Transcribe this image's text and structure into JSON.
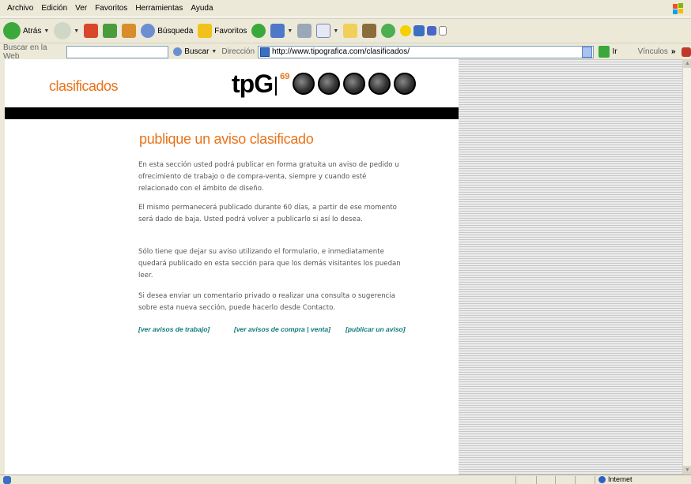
{
  "menu": [
    "Archivo",
    "Edición",
    "Ver",
    "Favoritos",
    "Herramientas",
    "Ayuda"
  ],
  "toolbar": {
    "back_label": "Atrás",
    "search_label": "Búsqueda",
    "favorites_label": "Favoritos"
  },
  "addressbar": {
    "search_label": "Buscar en la Web",
    "search_button": "Buscar",
    "address_label": "Dirección",
    "url": "http://www.tipografica.com/clasificados/",
    "go_label": "Ir",
    "links_label": "Vínculos"
  },
  "page": {
    "section": "clasificados",
    "logo_text": "tpG",
    "logo_number": "69",
    "headline": "publique un aviso clasificado",
    "paragraphs": [
      "En esta sección usted podrá publicar en forma gratuita un aviso de pedido u ofrecimiento de trabajo o de compra-venta, siempre y cuando esté relacionado con el ámbito de diseño.",
      "El mismo permanecerá publicado durante 60 días, a partir de ese momento será dado de baja. Usted podrá volver a publicarlo si así lo desea.",
      "Sólo tiene que dejar su aviso utilizando el formulario, e inmediatamente quedará publicado en esta sección para que los demás visitantes los puedan leer.",
      "Si desea enviar un comentario privado o realizar una consulta o sugerencia sobre esta nueva sección, puede hacerlo desde Contacto."
    ],
    "links": [
      "[ver avisos de trabajo]",
      "[ver avisos de compra | venta]",
      "[publicar un aviso]"
    ]
  },
  "statusbar": {
    "zone": "Internet"
  },
  "colors": {
    "accent_orange": "#e8731a",
    "link_teal": "#0f7a7a"
  }
}
